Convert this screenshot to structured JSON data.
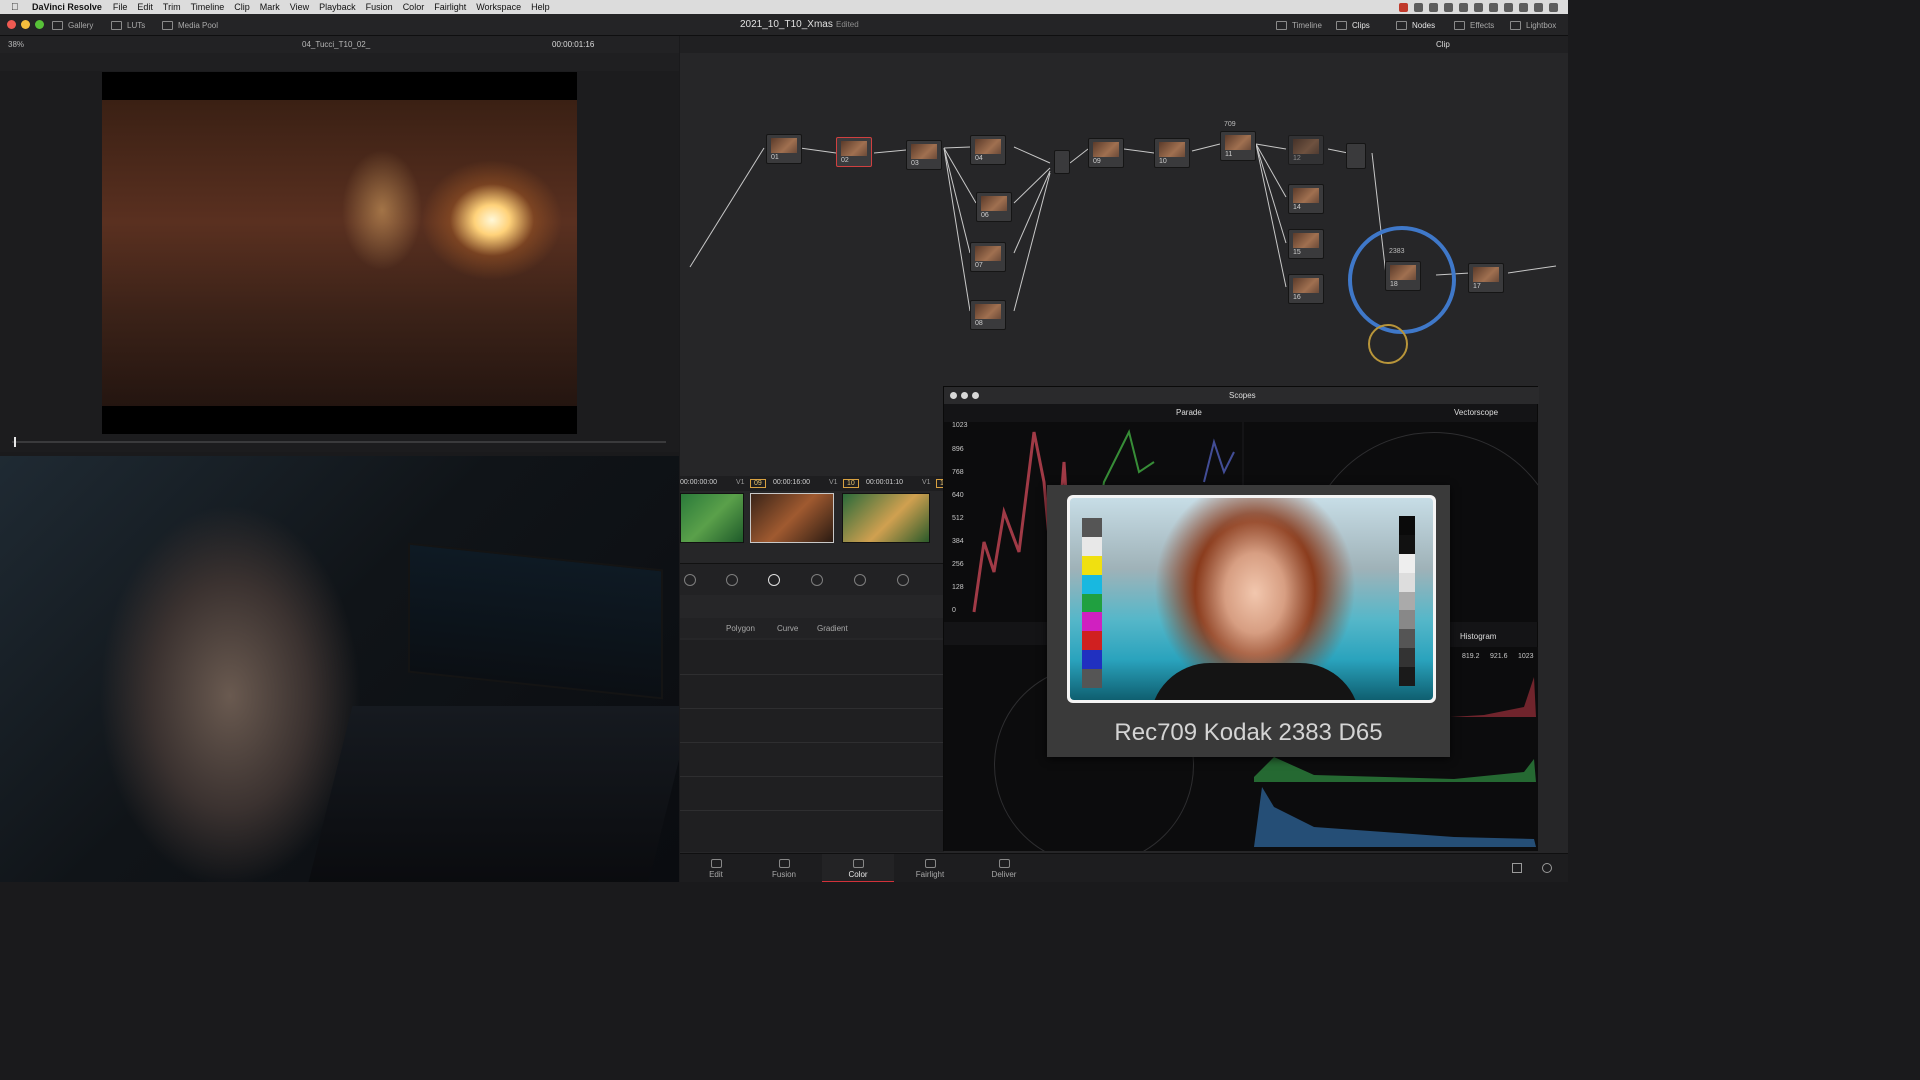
{
  "menubar": {
    "app_name": "DaVinci Resolve",
    "items": [
      "File",
      "Edit",
      "Trim",
      "Timeline",
      "Clip",
      "Mark",
      "View",
      "Playback",
      "Fusion",
      "Color",
      "Fairlight",
      "Workspace",
      "Help"
    ]
  },
  "toolbar": {
    "left": [
      "Gallery",
      "LUTs",
      "Media Pool"
    ],
    "project_title": "2021_10_T10_Xmas",
    "project_state": "Edited",
    "right": [
      "Timeline",
      "Clips",
      "Nodes",
      "Effects",
      "Lightbox"
    ]
  },
  "viewer": {
    "zoom": "38%",
    "clip_name": "04_Tucci_T10_02_",
    "timecode": "00:00:01:16"
  },
  "node_editor": {
    "mode": "Clip",
    "nodes": [
      "01",
      "02",
      "03",
      "04",
      "06",
      "07",
      "08",
      "09",
      "10",
      "11",
      "12",
      "14",
      "15",
      "16",
      "18",
      "17"
    ],
    "label_above_11": "709",
    "label_above_18": "2383"
  },
  "clips": {
    "items": [
      {
        "timecode": "00:00:00:00",
        "track": "V1",
        "index": "09"
      },
      {
        "timecode": "00:00:16:00",
        "track": "V1",
        "index": "10"
      },
      {
        "timecode": "00:00:01:10",
        "track": "V1",
        "index": "1"
      }
    ]
  },
  "window_tools": {
    "shapes": [
      "Polygon",
      "Curve",
      "Gradient"
    ]
  },
  "scopes": {
    "title": "Scopes",
    "left_scope": "Parade",
    "right_scope": "Vectorscope",
    "lower_right_scope": "Histogram",
    "y_axis": [
      "1023",
      "896",
      "768",
      "640",
      "512",
      "384",
      "256",
      "128",
      "0"
    ],
    "histogram_labels": [
      "819.2",
      "921.6",
      "1023"
    ]
  },
  "lut_overlay": {
    "caption": "Rec709 Kodak 2383 D65"
  },
  "pages": [
    {
      "label": "Edit"
    },
    {
      "label": "Fusion"
    },
    {
      "label": "Color",
      "active": true
    },
    {
      "label": "Fairlight"
    },
    {
      "label": "Deliver"
    }
  ],
  "colors": {
    "accent_ring": "#3f78c9",
    "active_page": "#d2323a",
    "node_connector": "#d6d63a"
  }
}
